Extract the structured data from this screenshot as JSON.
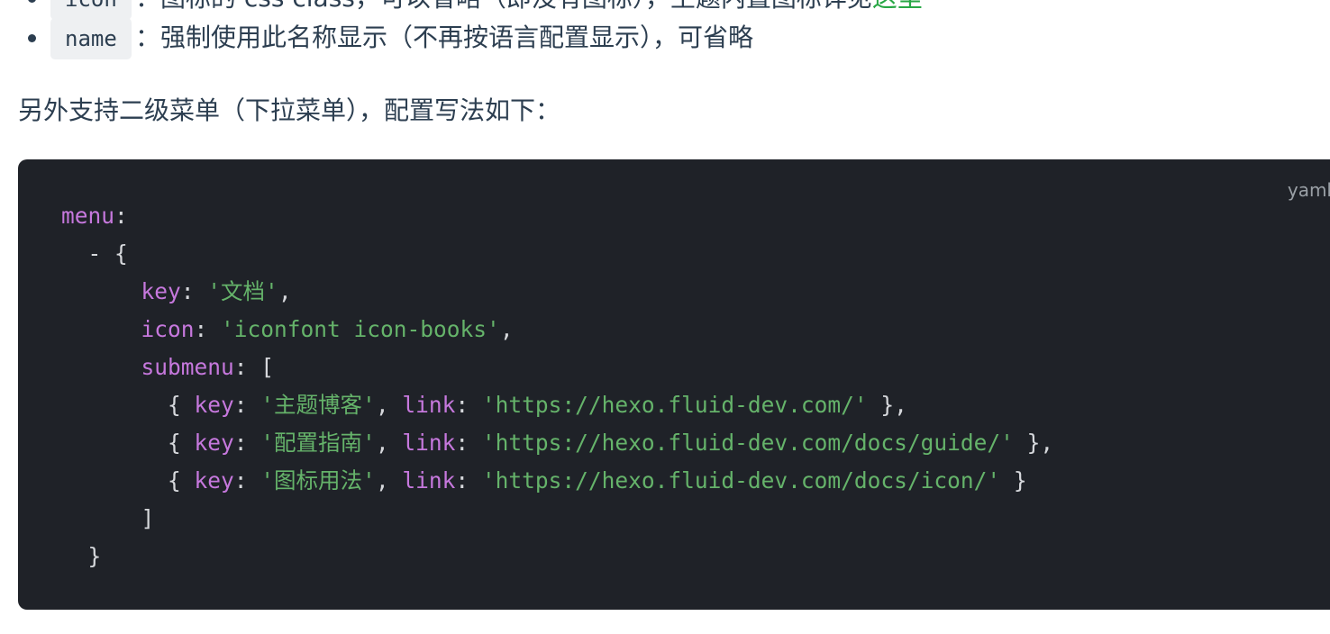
{
  "list": {
    "top_item": {
      "code": "icon",
      "text_before_link": "：图标的 css class，可以省略（即没有图标），主题内置图标详见",
      "link_text": "这里"
    },
    "second_item": {
      "code": "name",
      "text": "：强制使用此名称显示（不再按语言配置显示），可省略"
    }
  },
  "paragraph": "另外支持二级菜单（下拉菜单），配置写法如下：",
  "codeblock": {
    "language": "yaml",
    "lines": [
      [
        {
          "t": "k",
          "v": "menu"
        },
        {
          "t": "p",
          "v": ":"
        }
      ],
      [
        {
          "t": "p",
          "v": "  - {"
        }
      ],
      [
        {
          "t": "p",
          "v": "      "
        },
        {
          "t": "k",
          "v": "key"
        },
        {
          "t": "p",
          "v": ": "
        },
        {
          "t": "s",
          "v": "'文档'"
        },
        {
          "t": "p",
          "v": ","
        }
      ],
      [
        {
          "t": "p",
          "v": "      "
        },
        {
          "t": "k",
          "v": "icon"
        },
        {
          "t": "p",
          "v": ": "
        },
        {
          "t": "s",
          "v": "'iconfont icon-books'"
        },
        {
          "t": "p",
          "v": ","
        }
      ],
      [
        {
          "t": "p",
          "v": "      "
        },
        {
          "t": "k",
          "v": "submenu"
        },
        {
          "t": "p",
          "v": ": ["
        }
      ],
      [
        {
          "t": "p",
          "v": "        { "
        },
        {
          "t": "k",
          "v": "key"
        },
        {
          "t": "p",
          "v": ": "
        },
        {
          "t": "s",
          "v": "'主题博客'"
        },
        {
          "t": "p",
          "v": ", "
        },
        {
          "t": "k",
          "v": "link"
        },
        {
          "t": "p",
          "v": ": "
        },
        {
          "t": "s",
          "v": "'https://hexo.fluid-dev.com/'"
        },
        {
          "t": "p",
          "v": " },"
        }
      ],
      [
        {
          "t": "p",
          "v": "        { "
        },
        {
          "t": "k",
          "v": "key"
        },
        {
          "t": "p",
          "v": ": "
        },
        {
          "t": "s",
          "v": "'配置指南'"
        },
        {
          "t": "p",
          "v": ", "
        },
        {
          "t": "k",
          "v": "link"
        },
        {
          "t": "p",
          "v": ": "
        },
        {
          "t": "s",
          "v": "'https://hexo.fluid-dev.com/docs/guide/'"
        },
        {
          "t": "p",
          "v": " },"
        }
      ],
      [
        {
          "t": "p",
          "v": "        { "
        },
        {
          "t": "k",
          "v": "key"
        },
        {
          "t": "p",
          "v": ": "
        },
        {
          "t": "s",
          "v": "'图标用法'"
        },
        {
          "t": "p",
          "v": ", "
        },
        {
          "t": "k",
          "v": "link"
        },
        {
          "t": "p",
          "v": ": "
        },
        {
          "t": "s",
          "v": "'https://hexo.fluid-dev.com/docs/icon/'"
        },
        {
          "t": "p",
          "v": " }"
        }
      ],
      [
        {
          "t": "p",
          "v": "      ]"
        }
      ],
      [
        {
          "t": "p",
          "v": "  }"
        }
      ]
    ]
  },
  "colors": {
    "text": "#2c3e50",
    "link": "#28a745",
    "code_background": "#1f2228",
    "code_key": "#c678dd",
    "code_string": "#65b36a",
    "code_plain": "#d6d8dc",
    "inline_code_background": "#eef0f2"
  }
}
